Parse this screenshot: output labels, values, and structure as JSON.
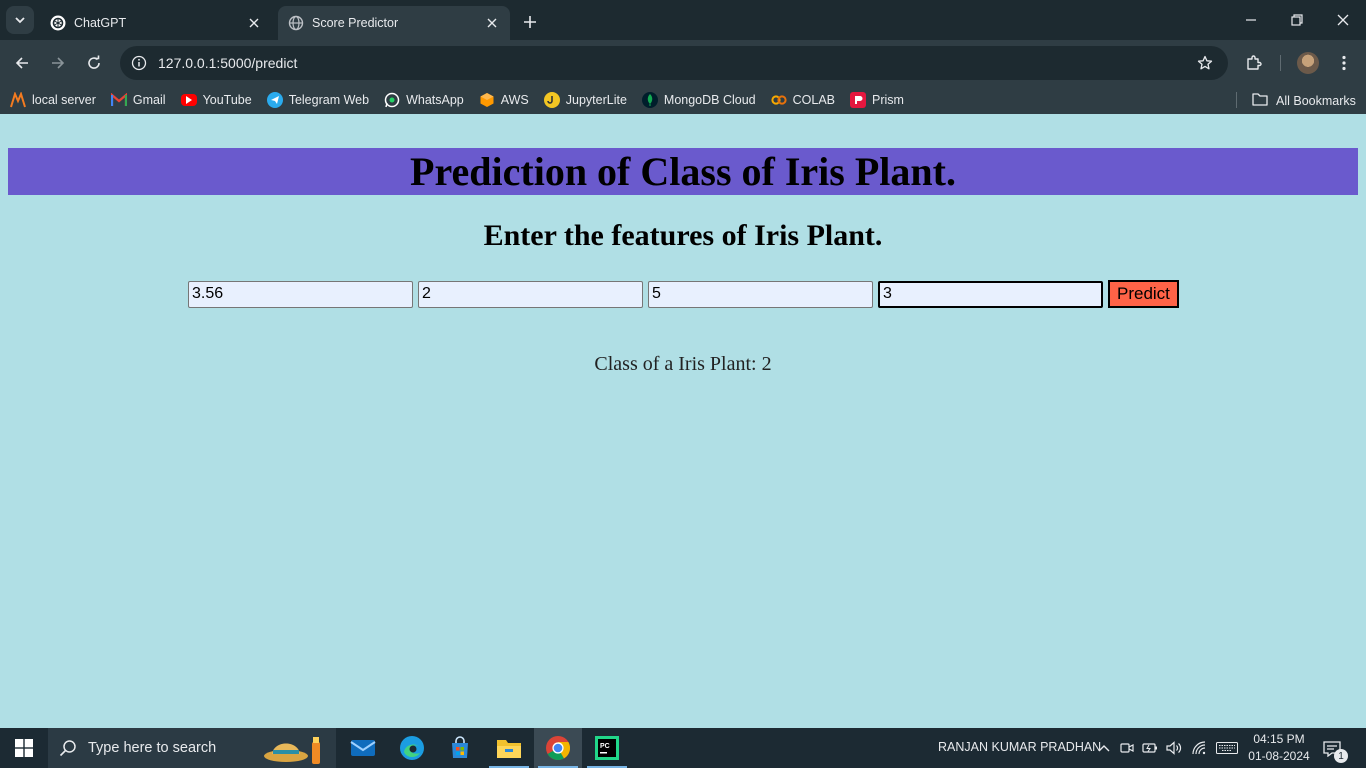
{
  "browser": {
    "tabs": [
      {
        "title": "ChatGPT",
        "active": false,
        "favicon": "chatgpt-icon"
      },
      {
        "title": "Score Predictor",
        "active": true,
        "favicon": "globe-icon"
      }
    ],
    "url": "127.0.0.1:5000/predict",
    "bookmarks": [
      {
        "label": "local server",
        "icon": "xampp-icon",
        "color": "#f47b20"
      },
      {
        "label": "Gmail",
        "icon": "gmail-icon",
        "color": "#ea4335"
      },
      {
        "label": "YouTube",
        "icon": "youtube-icon",
        "color": "#ff0000"
      },
      {
        "label": "Telegram Web",
        "icon": "telegram-icon",
        "color": "#2aabee"
      },
      {
        "label": "WhatsApp",
        "icon": "whatsapp-icon",
        "color": "#25d366"
      },
      {
        "label": "AWS",
        "icon": "aws-icon",
        "color": "#ff9900"
      },
      {
        "label": "JupyterLite",
        "icon": "jupyter-icon",
        "color": "#f3c623"
      },
      {
        "label": "MongoDB Cloud",
        "icon": "mongodb-icon",
        "color": "#13aa52"
      },
      {
        "label": "COLAB",
        "icon": "colab-icon",
        "color": "#f9ab00"
      },
      {
        "label": "Prism",
        "icon": "prism-icon",
        "color": "#e5173f"
      }
    ],
    "all_bookmarks": "All Bookmarks"
  },
  "page": {
    "banner_title": "Prediction of Class of Iris Plant.",
    "subtitle": "Enter the features of Iris Plant.",
    "features": [
      "3.56",
      "2",
      "5",
      "3"
    ],
    "predict_label": "Predict",
    "result": "Class of a Iris Plant: 2",
    "colors": {
      "background": "#b0dfe5",
      "banner": "#6a5acd",
      "button": "#ff6347",
      "input": "#e8f0fe"
    }
  },
  "taskbar": {
    "search_placeholder": "Type here to search",
    "apps": [
      "mail-icon",
      "edge-icon",
      "store-icon",
      "file-explorer-icon",
      "chrome-icon",
      "pycharm-icon"
    ],
    "user": "RANJAN KUMAR PRADHAN",
    "time": "04:15 PM",
    "date": "01-08-2024",
    "notifications": "1"
  }
}
